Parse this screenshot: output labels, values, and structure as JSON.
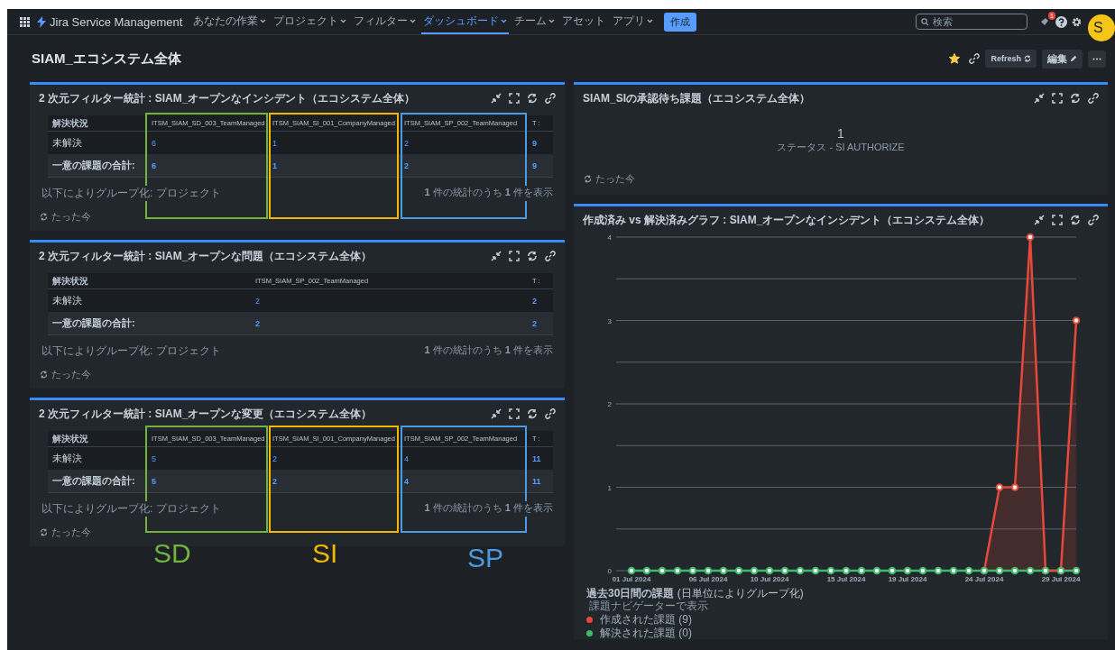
{
  "nav": {
    "app_name": "Jira Service Management",
    "menu": [
      {
        "label": "あなたの作業",
        "dropdown": true,
        "selected": false
      },
      {
        "label": "プロジェクト",
        "dropdown": true,
        "selected": false
      },
      {
        "label": "フィルター",
        "dropdown": true,
        "selected": false
      },
      {
        "label": "ダッシュボード",
        "dropdown": true,
        "selected": true
      },
      {
        "label": "チーム",
        "dropdown": true,
        "selected": false
      },
      {
        "label": "アセット",
        "dropdown": false,
        "selected": false
      },
      {
        "label": "アプリ",
        "dropdown": true,
        "selected": false
      }
    ],
    "create": "作成",
    "search": {
      "placeholder": "検索"
    },
    "notification_count": "1",
    "avatar": "S"
  },
  "page": {
    "title": "SIAM_エコシステム全体",
    "starred": true,
    "refresh": "Refresh",
    "edit": "編集"
  },
  "left_gadgets": [
    {
      "title": "2 次元フィルター統計 : SIAM_オープンなインシデント（エコシステム全体）",
      "columns": [
        "解決状況",
        "ITSM_SIAM_SD_003_TeamManaged",
        "ITSM_SIAM_SI_001_CompanyManaged",
        "ITSM_SIAM_SP_002_TeamManaged",
        "T :"
      ],
      "rows": [
        {
          "total_row": false,
          "cells": [
            "未解決",
            "6",
            "1",
            "2",
            "9"
          ]
        },
        {
          "total_row": true,
          "cells": [
            "一意の課題の合計:",
            "6",
            "1",
            "2",
            "9"
          ]
        }
      ],
      "group_by": "以下によりグループ化: プロジェクト",
      "summary": "**1** 件の統計のうち **1** 件を表示",
      "updated": "たった今",
      "highlights": [
        {
          "color": "#72b23e"
        },
        {
          "color": "#f2b705"
        },
        {
          "color": "#4c9be2"
        }
      ]
    },
    {
      "title": "2 次元フィルター統計 : SIAM_オープンな問題（エコシステム全体）",
      "columns": [
        "解決状況",
        "ITSM_SIAM_SP_002_TeamManaged",
        "T :"
      ],
      "rows": [
        {
          "total_row": false,
          "cells": [
            "未解決",
            "2",
            "2"
          ]
        },
        {
          "total_row": true,
          "cells": [
            "一意の課題の合計:",
            "2",
            "2"
          ]
        }
      ],
      "group_by": "以下によりグループ化: プロジェクト",
      "summary": "**1** 件の統計のうち **1** 件を表示",
      "updated": "たった今"
    },
    {
      "title": "2 次元フィルター統計 : SIAM_オープンな変更（エコシステム全体）",
      "columns": [
        "解決状況",
        "ITSM_SIAM_SD_003_TeamManaged",
        "ITSM_SIAM_SI_001_CompanyManaged",
        "ITSM_SIAM_SP_002_TeamManaged",
        "T :"
      ],
      "rows": [
        {
          "total_row": false,
          "cells": [
            "未解決",
            "5",
            "2",
            "4",
            "11"
          ]
        },
        {
          "total_row": true,
          "cells": [
            "一意の課題の合計:",
            "5",
            "2",
            "4",
            "11"
          ]
        }
      ],
      "group_by": "以下によりグループ化: プロジェクト",
      "summary": "**1** 件の統計のうち **1** 件を表示",
      "updated": "たった今",
      "highlights": [
        {
          "color": "#72b23e"
        },
        {
          "color": "#f2b705"
        },
        {
          "color": "#4c9be2"
        }
      ]
    }
  ],
  "annotations": [
    {
      "label": "SD",
      "color": "#72b23e"
    },
    {
      "label": "SI",
      "color": "#f2b705"
    },
    {
      "label": "SP",
      "color": "#4c9be2"
    }
  ],
  "filter_results": {
    "title": "SIAM_SIの承認待ち課題（エコシステム全体）",
    "count": "1",
    "status": "ステータス - SI AUTHORIZE",
    "updated": "たった今"
  },
  "created_vs_resolved": {
    "title": "作成済み vs 解決済みグラフ : SIAM_オープンなインシデント（エコシステム全体）",
    "chart_data": {
      "type": "line",
      "grid": true,
      "categories": [
        "01 Jul 2024",
        null,
        null,
        null,
        null,
        "06 Jul 2024",
        null,
        null,
        null,
        "10 Jul 2024",
        null,
        null,
        null,
        null,
        "15 Jul 2024",
        null,
        null,
        null,
        "19 Jul 2024",
        null,
        null,
        null,
        null,
        "24 Jul 2024",
        null,
        null,
        null,
        null,
        "29 Jul 2024",
        null
      ],
      "series": [
        {
          "name": "作成された課題",
          "color": "#e5493a",
          "marker": "circle",
          "values": [
            null,
            null,
            null,
            null,
            null,
            null,
            null,
            null,
            null,
            null,
            null,
            null,
            null,
            null,
            null,
            null,
            null,
            null,
            null,
            null,
            null,
            null,
            null,
            0,
            1,
            1,
            4,
            0,
            0,
            3
          ]
        },
        {
          "name": "解決された課題",
          "color": "#3dbb6b",
          "marker": "circle",
          "values": [
            0,
            0,
            0,
            0,
            0,
            0,
            0,
            0,
            0,
            0,
            0,
            0,
            0,
            0,
            0,
            0,
            0,
            0,
            0,
            0,
            0,
            0,
            0,
            0,
            0,
            0,
            0,
            0,
            0,
            0
          ]
        }
      ],
      "ylim": [
        0,
        4
      ],
      "yticks": [
        0,
        1,
        2,
        3,
        4
      ]
    },
    "caption": "**過去30日間の課題** (日単位によりグループ化)",
    "navigator_link": "課題ナビゲーターで表示",
    "legend": [
      {
        "count": "(9)"
      },
      {
        "count": "(0)"
      }
    ]
  }
}
